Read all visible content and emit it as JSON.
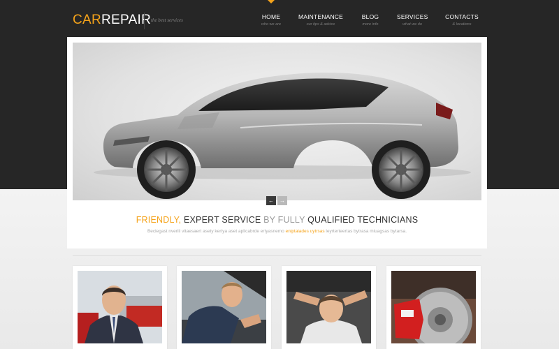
{
  "logo": {
    "part1": "CAR",
    "part2": "REPAIR"
  },
  "tagline": "the best services",
  "nav": {
    "items": [
      {
        "label": "HOME",
        "sub": "who we are"
      },
      {
        "label": "MAINTENANCE",
        "sub": "our tips & advice"
      },
      {
        "label": "BLOG",
        "sub": "more info"
      },
      {
        "label": "SERVICES",
        "sub": "what we do"
      },
      {
        "label": "CONTACTS",
        "sub": "& locations"
      }
    ]
  },
  "slider": {
    "prev": "←",
    "next": "→"
  },
  "headline": {
    "w1": "FRIENDLY,",
    "w2": "EXPERT SERVICE",
    "w3": "BY FULLY",
    "w4": "QUALIFIED TECHNICIANS"
  },
  "subtext": {
    "before": "Beclegast nverili vitaesaert  asety kertya aset aplicabrde ertyasnemo",
    "link": "eniptaiades uytrsas",
    "after": "leyrterteertas bytrasa miuagsas bytarsa."
  },
  "colors": {
    "accent": "#f5a31a",
    "header_bg": "#262626",
    "page_bg": "#efefef"
  }
}
